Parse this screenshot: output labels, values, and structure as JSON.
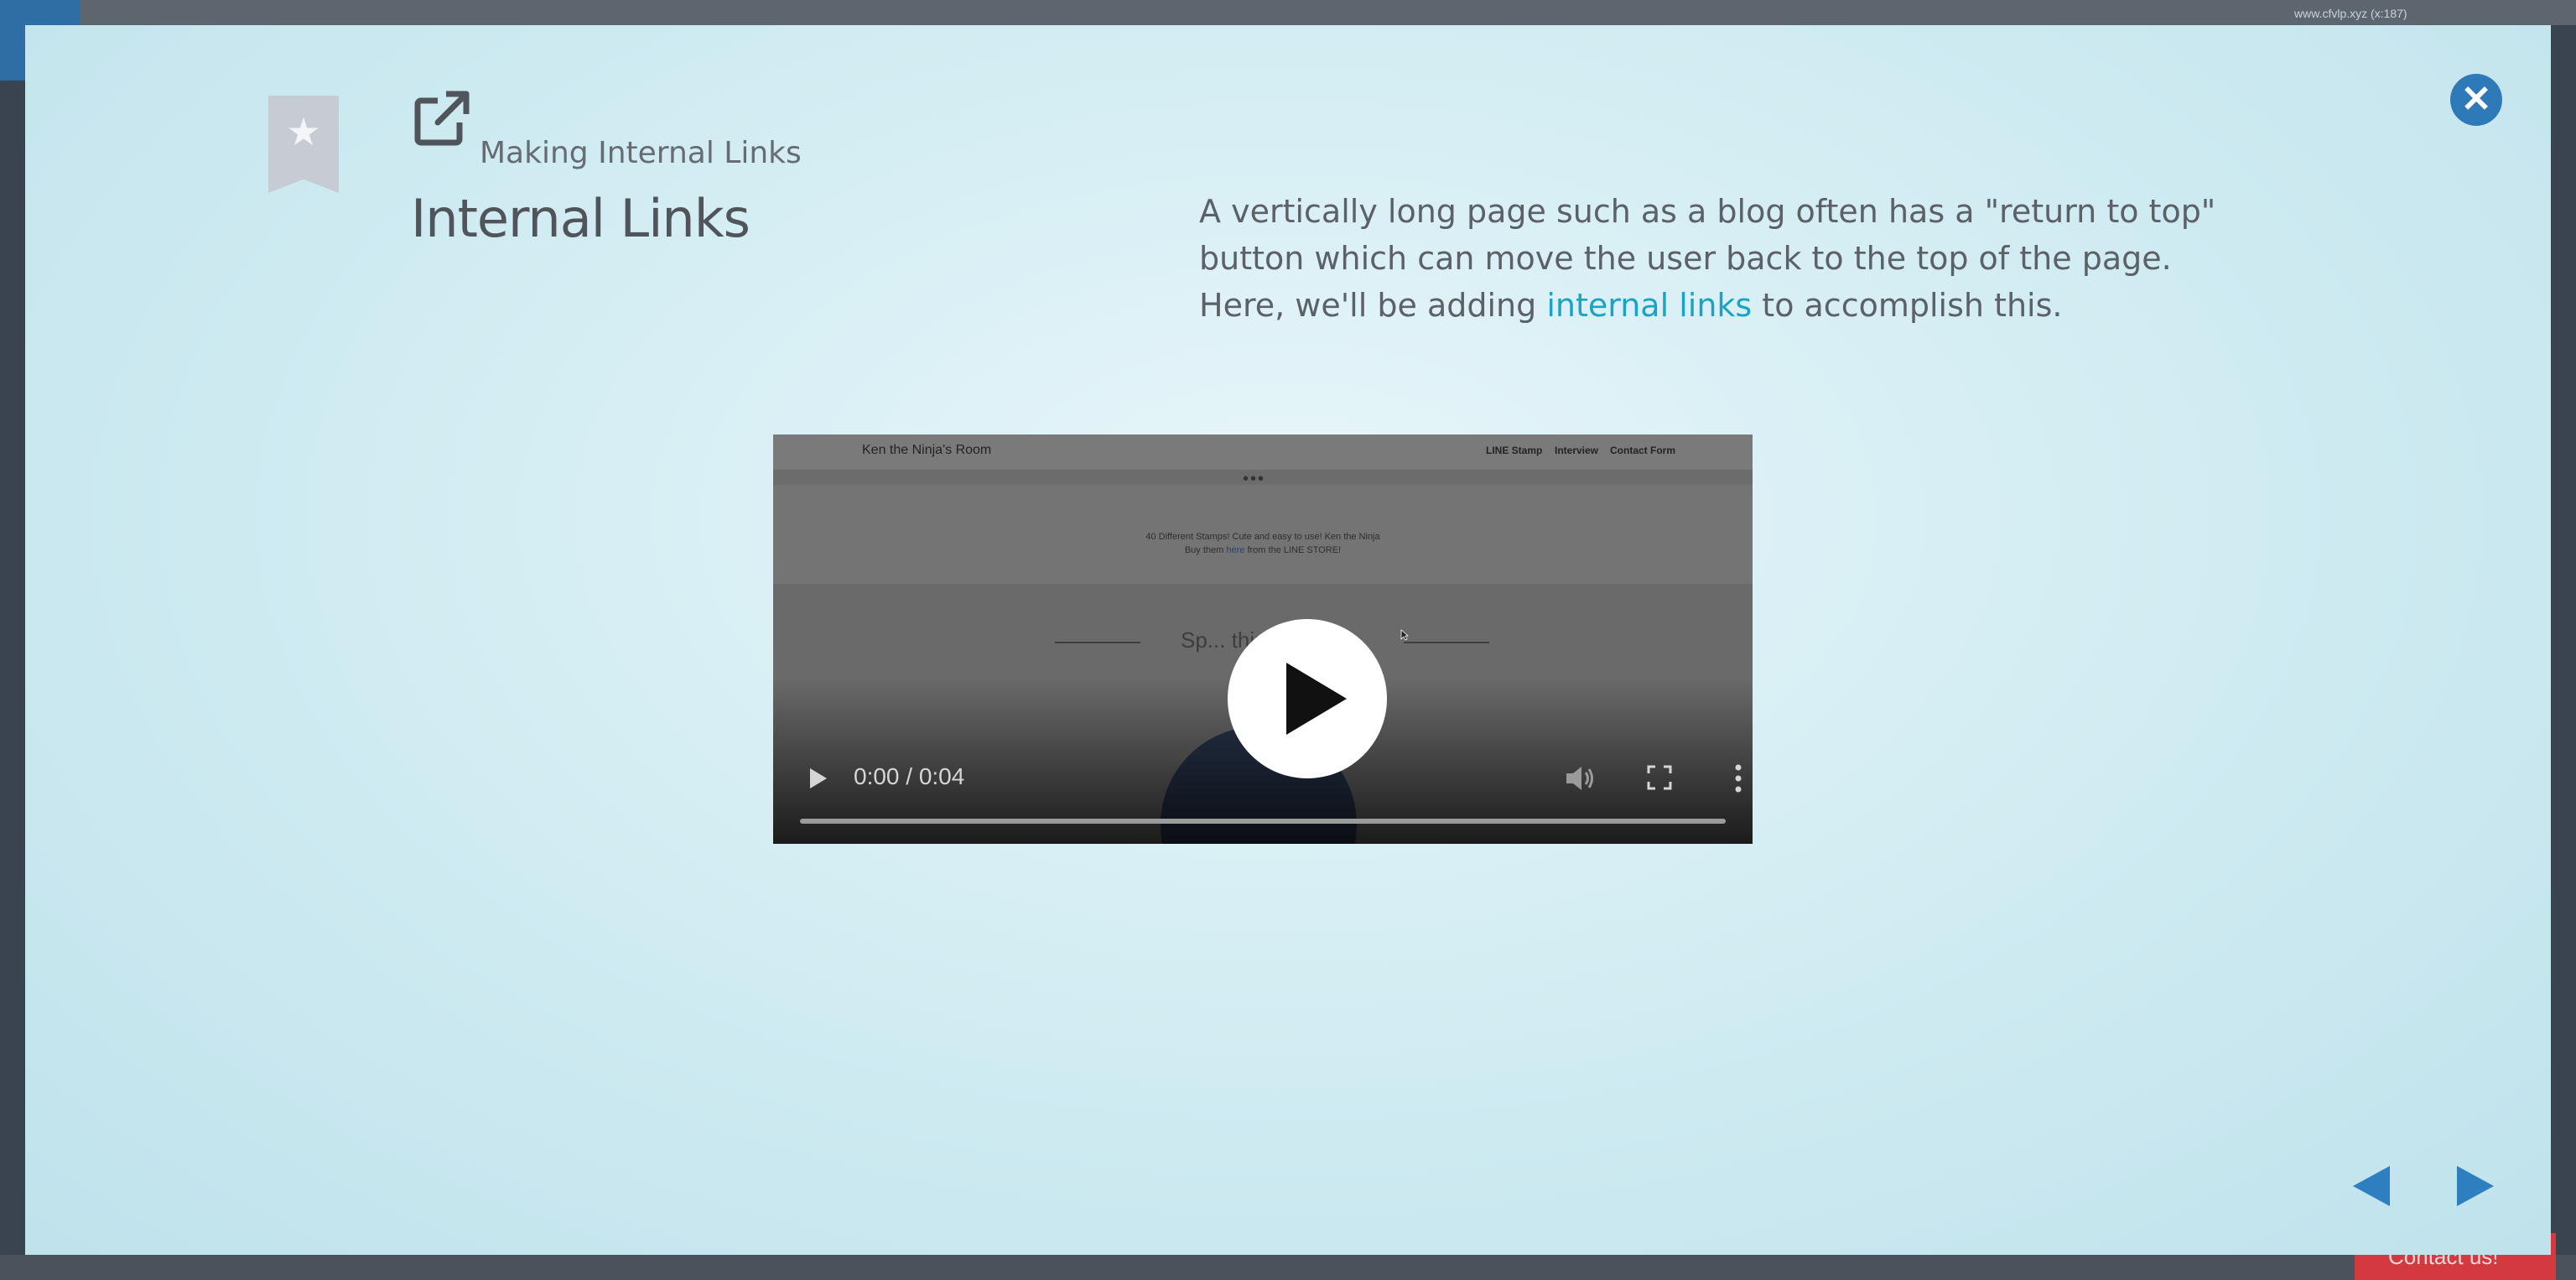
{
  "background": {
    "url_text": "www.cfvlp.xyz (x:187)",
    "contact_label": "Contact us!"
  },
  "modal": {
    "breadcrumb": "Making Internal Links",
    "title": "Internal Links",
    "description_line1": "A vertically long page such as a blog often has a \"return to top\" button which can move the user back to the top of the page.",
    "description_line2_prefix": "Here, we'll be adding ",
    "description_link": "internal links",
    "description_line2_suffix": " to accomplish this.",
    "icons": {
      "bookmark": "bookmark-star-icon",
      "external": "external-link-icon",
      "close": "close-icon",
      "prev": "prev-arrow-icon",
      "next": "next-arrow-icon"
    },
    "colors": {
      "accent": "#2e79b7",
      "link": "#1aa3c4"
    }
  },
  "video": {
    "site_title": "Ken the Ninja's Room",
    "nav": [
      "LINE Stamp",
      "Interview",
      "Contact Form"
    ],
    "banner_line1": "40 Different Stamps! Cute and easy to use! Ken the Ninja",
    "banner_line2_prefix": "Buy them ",
    "banner_here": "here",
    "banner_line2_suffix": " from the LINE STORE!",
    "section_heading": "Sp... thin...",
    "time": "0:00 / 0:04",
    "progress": 0
  }
}
